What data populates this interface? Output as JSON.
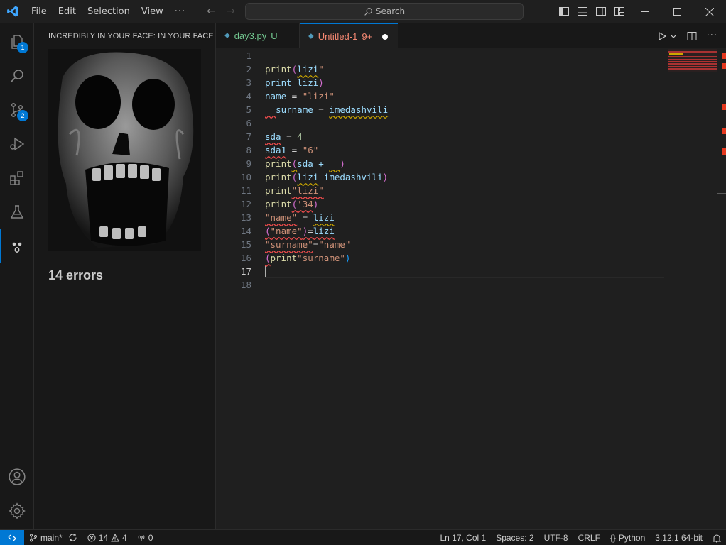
{
  "menu": [
    "File",
    "Edit",
    "Selection",
    "View",
    "···"
  ],
  "search": {
    "placeholder": "Search"
  },
  "activity": {
    "explorer_badge": "1",
    "scm_badge": "2"
  },
  "panel": {
    "title": "INCREDIBLY IN YOUR FACE: IN YOUR FACE",
    "errors_label": "14 errors"
  },
  "tabs": [
    {
      "name": "day3.py",
      "status": "U"
    },
    {
      "name": "Untitled-1",
      "status": "9+"
    }
  ],
  "editor": {
    "line_numbers": [
      "1",
      "2",
      "3",
      "4",
      "5",
      "6",
      "7",
      "8",
      "9",
      "10",
      "11",
      "12",
      "13",
      "14",
      "15",
      "16",
      "17",
      "18"
    ],
    "current_line": "17"
  },
  "status": {
    "branch": "main*",
    "errors": "14",
    "warnings": "4",
    "ports": "0",
    "position": "Ln 17, Col 1",
    "spaces": "Spaces: 2",
    "encoding": "UTF-8",
    "eol": "CRLF",
    "language": "Python",
    "interpreter": "3.12.1 64-bit"
  },
  "colors": {
    "accent": "#0078d4",
    "error": "#f14c4c",
    "warning": "#cca700"
  }
}
